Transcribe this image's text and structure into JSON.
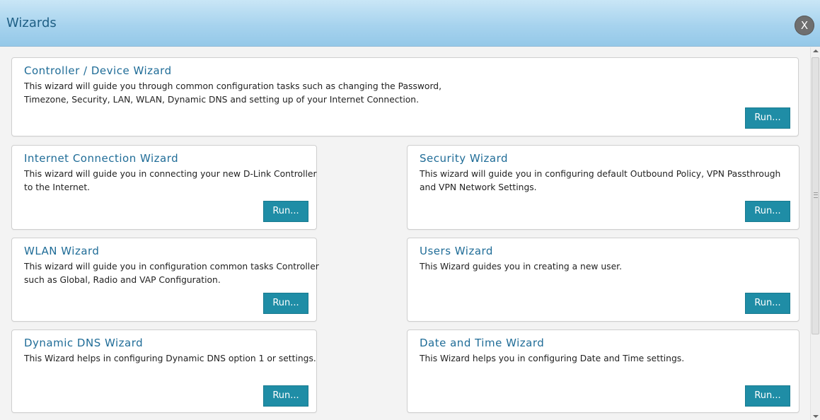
{
  "window": {
    "title": "Wizards",
    "close_label": "X"
  },
  "colors": {
    "title_bar": "#a7d3ee",
    "card_title": "#1f6c97",
    "run_button": "#1f8da6"
  },
  "wizards": [
    {
      "title": "Controller / Device Wizard",
      "description": "This wizard will guide you through common configuration tasks such as changing the Password,\nTimezone, Security, LAN, WLAN, Dynamic DNS and setting up of your Internet Connection.",
      "run_label": "Run..."
    },
    {
      "title": "Internet Connection Wizard",
      "description": "This wizard will guide you in connecting your new D-Link Controller to the Internet.",
      "run_label": "Run..."
    },
    {
      "title": "Security Wizard",
      "description": "This wizard will guide you in configuring default Outbound Policy, VPN Passthrough and VPN Network Settings.",
      "run_label": "Run..."
    },
    {
      "title": "WLAN Wizard",
      "description": "This wizard will guide you in configuration common tasks Controller such as Global, Radio and VAP Configuration.",
      "run_label": "Run..."
    },
    {
      "title": "Users Wizard",
      "description": "This Wizard guides you in creating a new user.",
      "run_label": "Run..."
    },
    {
      "title": "Dynamic DNS Wizard",
      "description": "This Wizard helps in configuring Dynamic DNS option 1 or settings.",
      "run_label": "Run..."
    },
    {
      "title": "Date and Time Wizard",
      "description": "This Wizard helps you in configuring Date and Time settings.",
      "run_label": "Run..."
    }
  ]
}
